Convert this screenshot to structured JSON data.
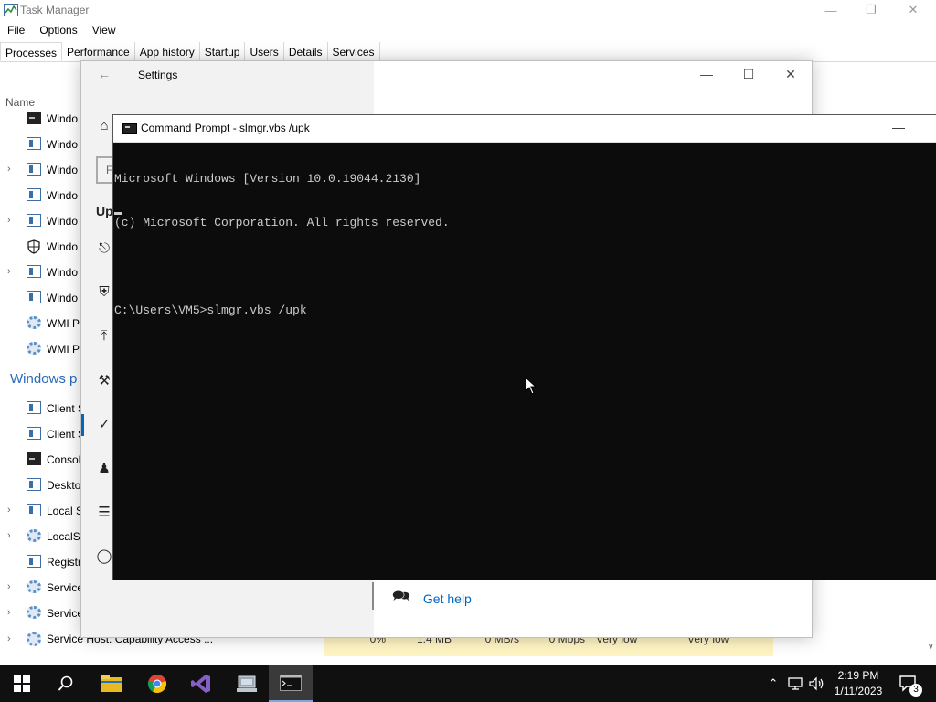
{
  "task_manager": {
    "title": "Task Manager",
    "menu": [
      "File",
      "Options",
      "View"
    ],
    "tabs": [
      "Processes",
      "Performance",
      "App history",
      "Startup",
      "Users",
      "Details",
      "Services"
    ],
    "column_name": "Name",
    "processes": [
      {
        "name": "Windo",
        "icon": "console",
        "chev": ""
      },
      {
        "name": "Windo",
        "icon": "window",
        "chev": ""
      },
      {
        "name": "Windo",
        "icon": "window",
        "chev": ">"
      },
      {
        "name": "Windo",
        "icon": "window",
        "chev": ""
      },
      {
        "name": "Windo",
        "icon": "window",
        "chev": ">"
      },
      {
        "name": "Windo",
        "icon": "shield",
        "chev": ""
      },
      {
        "name": "Windo",
        "icon": "window",
        "chev": ">"
      },
      {
        "name": "Windo",
        "icon": "window",
        "chev": ""
      },
      {
        "name": "WMI P",
        "icon": "gear",
        "chev": ""
      },
      {
        "name": "WMI P",
        "icon": "gear",
        "chev": ""
      }
    ],
    "group_heading": "Windows p",
    "processes2": [
      {
        "name": "Client S",
        "icon": "window",
        "chev": ""
      },
      {
        "name": "Client S",
        "icon": "window",
        "chev": ""
      },
      {
        "name": "Consol",
        "icon": "console",
        "chev": ""
      },
      {
        "name": "Deskto",
        "icon": "window",
        "chev": ""
      },
      {
        "name": "Local S",
        "icon": "window",
        "chev": ">"
      },
      {
        "name": "LocalSe",
        "icon": "gear",
        "chev": ">"
      },
      {
        "name": "Registr",
        "icon": "window",
        "chev": ""
      },
      {
        "name": "Service",
        "icon": "gear",
        "chev": ">"
      },
      {
        "name": "Service",
        "icon": "gear",
        "chev": ">"
      }
    ],
    "bottom_row": {
      "name": "Service Host: Capability Access ...",
      "cpu": "0%",
      "memory": "1.4 MB",
      "disk": "0 MB/s",
      "network": "0 Mbps",
      "power": "Very low",
      "power_trend": "Very low"
    }
  },
  "settings": {
    "title": "Settings",
    "search_fragment": "F",
    "heading_fragment": "Up",
    "help_link": "Get help",
    "sidebar_icons": [
      "home-icon",
      "delivery-icon",
      "shield-icon",
      "upload-icon",
      "wrench-icon",
      "check-circle-icon",
      "person-icon",
      "tools-icon",
      "cat-icon"
    ]
  },
  "cmd": {
    "title": "Command Prompt - slmgr.vbs  /upk",
    "lines": [
      "Microsoft Windows [Version 10.0.19044.2130]",
      "(c) Microsoft Corporation. All rights reserved.",
      "",
      "C:\\Users\\VM5>slmgr.vbs /upk"
    ]
  },
  "taskbar": {
    "time": "2:19 PM",
    "date": "1/11/2023",
    "notification_count": "3",
    "apps": [
      "start-icon",
      "search-icon",
      "file-explorer-icon",
      "chrome-icon",
      "visual-studio-icon",
      "network-manager-icon",
      "command-prompt-icon"
    ]
  },
  "colors": {
    "accent": "#0067c0",
    "console_bg": "#0c0c0c",
    "console_fg": "#cccccc",
    "taskbar_bg": "#101010",
    "heat_cell": "#fff5c4"
  }
}
